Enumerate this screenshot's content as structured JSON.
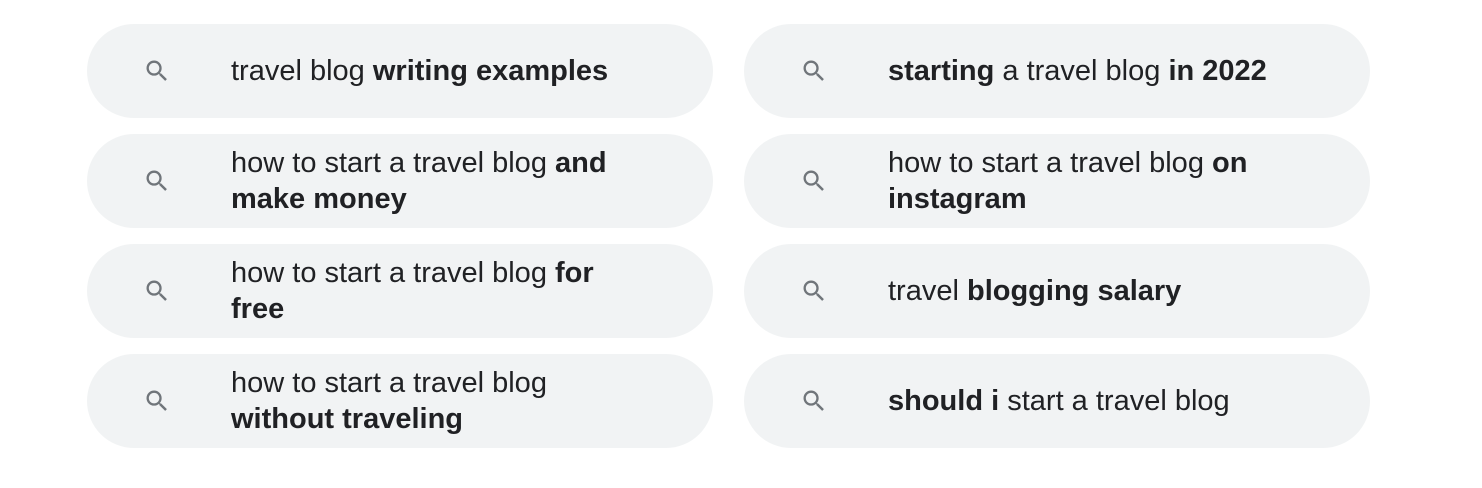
{
  "related_searches": [
    {
      "segments": [
        {
          "text": "travel blog ",
          "bold": false
        },
        {
          "text": "writing examples",
          "bold": true
        }
      ],
      "icon": "search-icon"
    },
    {
      "segments": [
        {
          "text": "starting",
          "bold": true
        },
        {
          "text": " a travel blog ",
          "bold": false
        },
        {
          "text": "in 2022",
          "bold": true
        }
      ],
      "icon": "search-icon"
    },
    {
      "segments": [
        {
          "text": "how to start a travel blog ",
          "bold": false
        },
        {
          "text": "and make money",
          "bold": true
        }
      ],
      "icon": "search-icon"
    },
    {
      "segments": [
        {
          "text": "how to start a travel blog ",
          "bold": false
        },
        {
          "text": "on instagram",
          "bold": true
        }
      ],
      "icon": "search-icon"
    },
    {
      "segments": [
        {
          "text": "how to start a travel blog ",
          "bold": false
        },
        {
          "text": "for free",
          "bold": true
        }
      ],
      "icon": "search-icon"
    },
    {
      "segments": [
        {
          "text": "travel ",
          "bold": false
        },
        {
          "text": "blogging salary",
          "bold": true
        }
      ],
      "icon": "search-icon"
    },
    {
      "segments": [
        {
          "text": "how to start a travel blog ",
          "bold": false
        },
        {
          "text": "without traveling",
          "bold": true
        }
      ],
      "icon": "search-icon"
    },
    {
      "segments": [
        {
          "text": "should i",
          "bold": true
        },
        {
          "text": " start a travel blog",
          "bold": false
        }
      ],
      "icon": "search-icon"
    }
  ],
  "colors": {
    "chip_background": "#f1f3f4",
    "text": "#202124",
    "icon": "#70757a"
  }
}
